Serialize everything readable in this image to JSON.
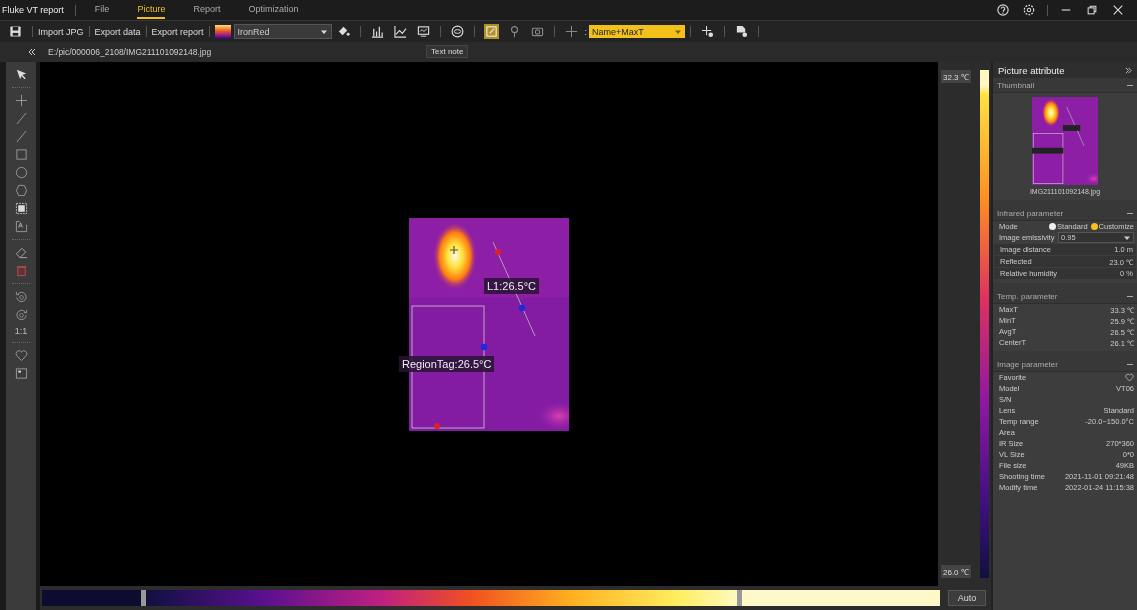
{
  "app_title": "Fluke VT report",
  "menu": [
    {
      "label": "File",
      "selected": false
    },
    {
      "label": "Picture",
      "selected": true
    },
    {
      "label": "Report",
      "selected": false
    },
    {
      "label": "Optimization",
      "selected": false
    }
  ],
  "toolbar": {
    "buttons": [
      "Import JPG",
      "Export data",
      "Export report"
    ],
    "palette": "IronRed",
    "text_note_active": true,
    "separator": ":",
    "label_mode": "Name+MaxT"
  },
  "tooltip": "Text note",
  "file_path": "E:/pic/000006_2108/IMG211101092148.jpg",
  "tools": [
    {
      "kind": "select"
    },
    {
      "kind": "sep"
    },
    {
      "kind": "cross"
    },
    {
      "kind": "line"
    },
    {
      "kind": "line"
    },
    {
      "kind": "rect"
    },
    {
      "kind": "circle"
    },
    {
      "kind": "polygon"
    },
    {
      "kind": "region"
    },
    {
      "kind": "text"
    },
    {
      "kind": "sep"
    },
    {
      "kind": "eraser"
    },
    {
      "kind": "delete"
    },
    {
      "kind": "sep"
    },
    {
      "kind": "rotate-left"
    },
    {
      "kind": "rotate-right"
    },
    {
      "kind": "ratio",
      "label": "1:1"
    },
    {
      "kind": "sep"
    },
    {
      "kind": "heart"
    },
    {
      "kind": "picture"
    }
  ],
  "image": {
    "line_label": "L1:26.5°C",
    "region_label": "RegionTag:26.5°C"
  },
  "scale": {
    "max": "32.3 ℃",
    "min": "26.0 ℃",
    "auto": "Auto",
    "range_low": {
      "level": 0.11
    },
    "range_high": {
      "level": 0.78
    }
  },
  "panel": {
    "title": "Picture attribute",
    "thumbnail": {
      "title": "Thumbnail",
      "caption": "IMG211101092148.jpg"
    },
    "infrared": {
      "title": "Infrared parameter",
      "mode_label": "Mode",
      "modes": [
        {
          "label": "Standard",
          "selected": false
        },
        {
          "label": "Customize",
          "selected": true
        }
      ],
      "emissivity_label": "Image emissivity",
      "emissivity": "0.95",
      "rows": [
        {
          "label": "Image distance",
          "value": "1.0 m"
        },
        {
          "label": "Reflected",
          "value": "23.0 ℃"
        },
        {
          "label": "Relative humidity",
          "value": "0 %"
        }
      ]
    },
    "temp": {
      "title": "Temp. parameter",
      "rows": [
        {
          "label": "MaxT",
          "value": "33.3 ℃"
        },
        {
          "label": "MinT",
          "value": "25.9 ℃"
        },
        {
          "label": "AvgT",
          "value": "26.5 ℃"
        },
        {
          "label": "CenterT",
          "value": "26.1 ℃"
        }
      ]
    },
    "image_params": {
      "title": "Image parameter",
      "favorite_label": "Favorite",
      "rows": [
        {
          "label": "Model",
          "value": "VT06"
        },
        {
          "label": "S/N"
        },
        {
          "label": "Lens",
          "value": "Standard"
        },
        {
          "label": "Temp range",
          "value": "-20.0~150.0°C"
        },
        {
          "label": "Area"
        },
        {
          "label": "IR Size",
          "value": "270*360"
        },
        {
          "label": "VL Size",
          "value": "0*0"
        },
        {
          "label": "File size",
          "value": "49KB"
        },
        {
          "label": "Shooting time",
          "value": "2021-11-01 09:21:48"
        },
        {
          "label": "Modify time",
          "value": "2022-01-24 11:15:38"
        }
      ]
    }
  }
}
